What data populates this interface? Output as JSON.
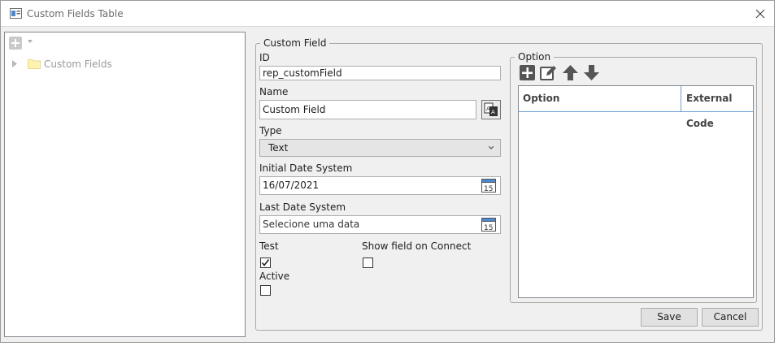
{
  "window": {
    "title": "Custom Fields Table"
  },
  "tree": {
    "items": [
      {
        "label": "Custom Fields",
        "icon": "folder-icon"
      }
    ]
  },
  "form": {
    "group_title": "Custom Field",
    "id_label": "ID",
    "id_value": "rep_customField",
    "name_label": "Name",
    "name_value": "Custom Field",
    "type_label": "Type",
    "type_value": "Text",
    "initial_date_label": "Initial Date System",
    "initial_date_value": "16/07/2021",
    "last_date_label": "Last Date System",
    "last_date_placeholder": "Selecione uma data",
    "calendar_day": "15",
    "test_label": "Test",
    "test_checked": true,
    "show_connect_label": "Show field on Connect",
    "show_connect_checked": false,
    "active_label": "Active",
    "active_checked": false
  },
  "options": {
    "group_title": "Option",
    "columns": [
      "Option",
      "External Code"
    ],
    "rows": []
  },
  "buttons": {
    "save": "Save",
    "cancel": "Cancel"
  },
  "colors": {
    "accent": "#6a9fd6",
    "icon_gray": "#555555",
    "folder": "#fff3b0"
  }
}
